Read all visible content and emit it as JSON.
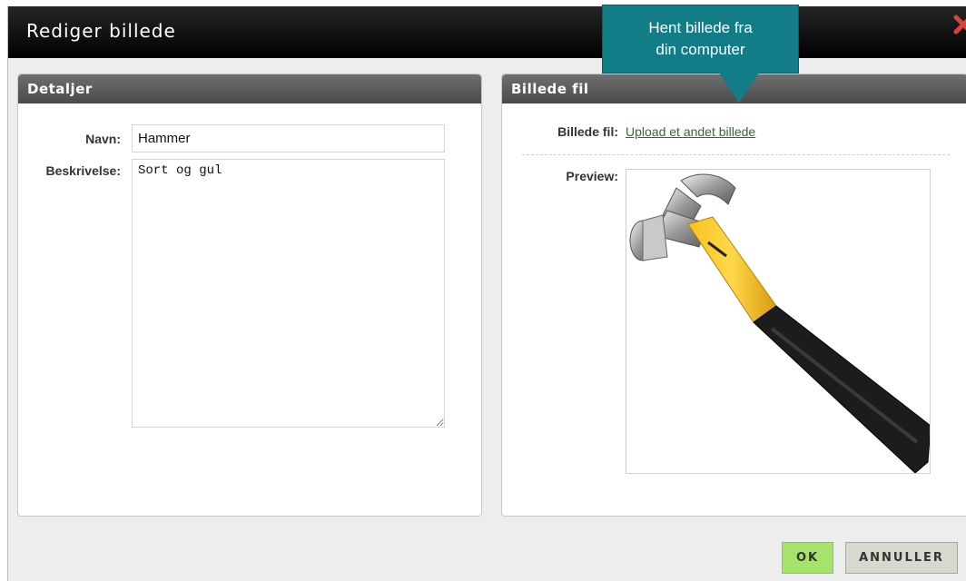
{
  "dialog": {
    "title": "Rediger billede"
  },
  "details_panel": {
    "header": "Detaljer",
    "name_label": "Navn:",
    "name_value": "Hammer",
    "description_label": "Beskrivelse:",
    "description_value": "Sort og gul"
  },
  "file_panel": {
    "header": "Billede fil",
    "file_label": "Billede fil:",
    "upload_link": "Upload et andet billede",
    "preview_label": "Preview:"
  },
  "buttons": {
    "ok": "OK",
    "cancel": "ANNULLER"
  },
  "tooltip": {
    "line1": "Hent billede fra",
    "line2": "din computer"
  },
  "colors": {
    "ok_button": "#a6e36c",
    "tooltip": "#137d87",
    "close_icon": "#d8453a",
    "link": "#2f6b2f"
  },
  "icons": {
    "close": "close-icon"
  }
}
